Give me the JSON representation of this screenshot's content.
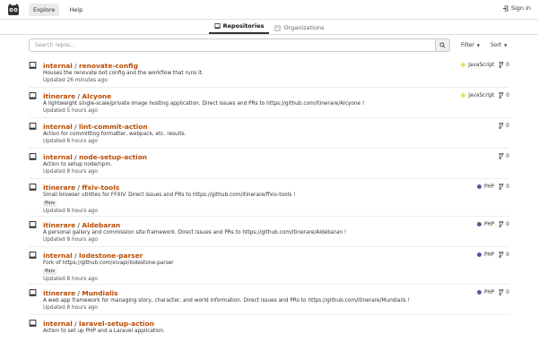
{
  "nav": {
    "explore": "Explore",
    "help": "Help",
    "sign_in": "Sign in"
  },
  "tabs": [
    {
      "label": "Repositories",
      "active": true,
      "icon": "repo-icon"
    },
    {
      "label": "Organizations",
      "active": false,
      "icon": "organization-icon"
    }
  ],
  "search": {
    "placeholder": "Search repos..."
  },
  "filters": {
    "filter": "Filter",
    "sort": "Sort"
  },
  "colors": {
    "accent": "#b84a00",
    "javascript": "#f1e05a",
    "php": "#4f5d95"
  },
  "repos": [
    {
      "owner": "internal",
      "name": "renovate-config",
      "desc": "Houses the renovate bot config and the workflow that runs it.",
      "updated": "Updated 26 minutes ago",
      "lang": "JavaScript",
      "forks": "0",
      "topics": []
    },
    {
      "owner": "itinerare",
      "name": "Alcyone",
      "desc": "A lightweight single-scale/private image hosting application. Direct issues and PRs to https://github.com/itinerare/Alcyone !",
      "updated": "Updated 5 hours ago",
      "lang": "JavaScript",
      "forks": "0",
      "topics": []
    },
    {
      "owner": "internal",
      "name": "lint-commit-action",
      "desc": "Action for committing formatter, webpack, etc. results.",
      "updated": "Updated 6 hours ago",
      "lang": "",
      "forks": "0",
      "topics": []
    },
    {
      "owner": "internal",
      "name": "node-setup-action",
      "desc": "Action to setup node/npm.",
      "updated": "Updated 8 hours ago",
      "lang": "",
      "forks": "0",
      "topics": []
    },
    {
      "owner": "itinerare",
      "name": "ffxiv-tools",
      "desc": "Small browser utilities for FFXIV. Direct issues and PRs to https://github.com/itinerare/ffxiv-tools !",
      "updated": "Updated 8 hours ago",
      "lang": "PHP",
      "forks": "0",
      "topics": [
        "ffxiv"
      ]
    },
    {
      "owner": "itinerare",
      "name": "Aldebaran",
      "desc": "A personal gallery and commission site framework. Direct issues and PRs to https://github.com/itinerare/Aldebaran !",
      "updated": "Updated 8 hours ago",
      "lang": "PHP",
      "forks": "0",
      "topics": []
    },
    {
      "owner": "internal",
      "name": "lodestone-parser",
      "desc": "Fork of https://github.com/xivapi/lodestone-parser",
      "updated": "Updated 8 hours ago",
      "lang": "PHP",
      "forks": "0",
      "topics": [
        "ffxiv"
      ]
    },
    {
      "owner": "itinerare",
      "name": "Mundialis",
      "desc": "A web app framework for managing story, character, and world information. Direct issues and PRs to https://github.com/itinerare/Mundialis !",
      "updated": "Updated 8 hours ago",
      "lang": "PHP",
      "forks": "0",
      "topics": []
    },
    {
      "owner": "internal",
      "name": "laravel-setup-action",
      "desc": "Action to set up PHP and a Laravel application.",
      "updated": "",
      "lang": "",
      "forks": "",
      "topics": []
    }
  ]
}
